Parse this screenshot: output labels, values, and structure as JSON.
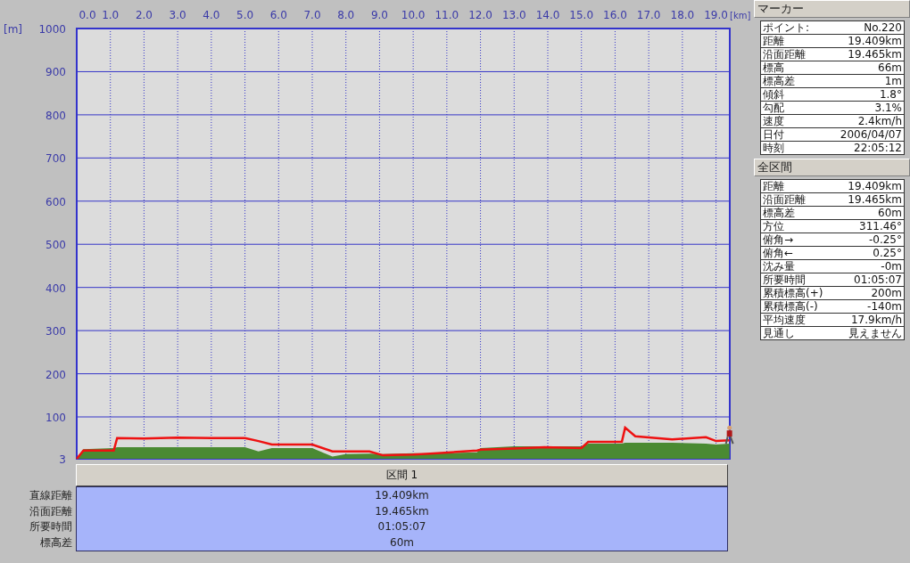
{
  "chart": {
    "y_unit": "[m]",
    "x_unit": "[km]",
    "chart_data": {
      "type": "area",
      "x": [
        0,
        0.2,
        1.1,
        1.2,
        2,
        3,
        4,
        5,
        5.4,
        5.8,
        7,
        7.6,
        8,
        8.7,
        9.1,
        10,
        10.5,
        11.9,
        12,
        13,
        13.9,
        15,
        15.2,
        16.2,
        16.3,
        16.6,
        17.7,
        18.7,
        19,
        19.4
      ],
      "series": [
        {
          "type": "area",
          "color": "#4a8a32",
          "values": [
            3,
            25,
            28,
            30,
            30,
            30,
            30,
            30,
            20,
            28,
            28,
            8,
            14,
            15,
            14,
            16,
            15,
            18,
            28,
            32,
            32,
            32,
            38,
            38,
            40,
            40,
            40,
            38,
            36,
            38
          ]
        },
        {
          "type": "line",
          "color": "#ee1111",
          "values": [
            3,
            22,
            22,
            51,
            50,
            52,
            51,
            51,
            44,
            36,
            36,
            20,
            20,
            20,
            11,
            13,
            15,
            22,
            24,
            27,
            30,
            28,
            42,
            42,
            75,
            55,
            48,
            53,
            44,
            46
          ]
        }
      ],
      "xlim": [
        0,
        19.409
      ],
      "ylim": [
        3,
        1000
      ],
      "xticks": [
        {
          "value": 0,
          "label": "0.0"
        },
        {
          "value": 1,
          "label": "1.0"
        },
        {
          "value": 2,
          "label": "2.0"
        },
        {
          "value": 3,
          "label": "3.0"
        },
        {
          "value": 4,
          "label": "4.0"
        },
        {
          "value": 5,
          "label": "5.0"
        },
        {
          "value": 6,
          "label": "6.0"
        },
        {
          "value": 7,
          "label": "7.0"
        },
        {
          "value": 8,
          "label": "8.0"
        },
        {
          "value": 9,
          "label": "9.0"
        },
        {
          "value": 10,
          "label": "10.0"
        },
        {
          "value": 11,
          "label": "11.0"
        },
        {
          "value": 12,
          "label": "12.0"
        },
        {
          "value": 13,
          "label": "13.0"
        },
        {
          "value": 14,
          "label": "14.0"
        },
        {
          "value": 15,
          "label": "15.0"
        },
        {
          "value": 16,
          "label": "16.0"
        },
        {
          "value": 17,
          "label": "17.0"
        },
        {
          "value": 18,
          "label": "18.0"
        },
        {
          "value": 19,
          "label": "19.0"
        }
      ],
      "grid": true,
      "yticks": [
        3,
        100,
        200,
        300,
        400,
        500,
        600,
        700,
        800,
        900,
        1000
      ]
    }
  },
  "section_table": {
    "header": "区間 1",
    "rows": [
      {
        "label": "直線距離",
        "value": "19.409km"
      },
      {
        "label": "沿面距離",
        "value": "19.465km"
      },
      {
        "label": "所要時間",
        "value": "01:05:07"
      },
      {
        "label": "標高差",
        "value": "60m"
      }
    ]
  },
  "panels": [
    {
      "title": "マーカー",
      "rows": [
        {
          "label": "ポイント:",
          "value": "No.220"
        },
        {
          "label": "距離",
          "value": "19.409km"
        },
        {
          "label": "沿面距離",
          "value": "19.465km"
        },
        {
          "label": "標高",
          "value": "66m"
        },
        {
          "label": "標高差",
          "value": "1m"
        },
        {
          "label": "傾斜",
          "value": "1.8°"
        },
        {
          "label": "勾配",
          "value": "3.1%"
        },
        {
          "label": "速度",
          "value": "2.4km/h"
        },
        {
          "label": "日付",
          "value": "2006/04/07"
        },
        {
          "label": "時刻",
          "value": "22:05:12"
        }
      ]
    },
    {
      "title": "全区間",
      "rows": [
        {
          "label": "距離",
          "value": "19.409km"
        },
        {
          "label": "沿面距離",
          "value": "19.465km"
        },
        {
          "label": "標高差",
          "value": "60m"
        },
        {
          "label": "方位",
          "value": "311.46°"
        },
        {
          "label": "俯角→",
          "value": "-0.25°"
        },
        {
          "label": "俯角←",
          "value": "0.25°"
        },
        {
          "label": "沈み量",
          "value": "-0m"
        },
        {
          "label": "所要時間",
          "value": "01:05:07"
        },
        {
          "label": "累積標高(+)",
          "value": "200m"
        },
        {
          "label": "累積標高(-)",
          "value": "-140m"
        },
        {
          "label": "平均速度",
          "value": "17.9km/h"
        },
        {
          "label": "見通し",
          "value": "見えません"
        }
      ]
    }
  ]
}
